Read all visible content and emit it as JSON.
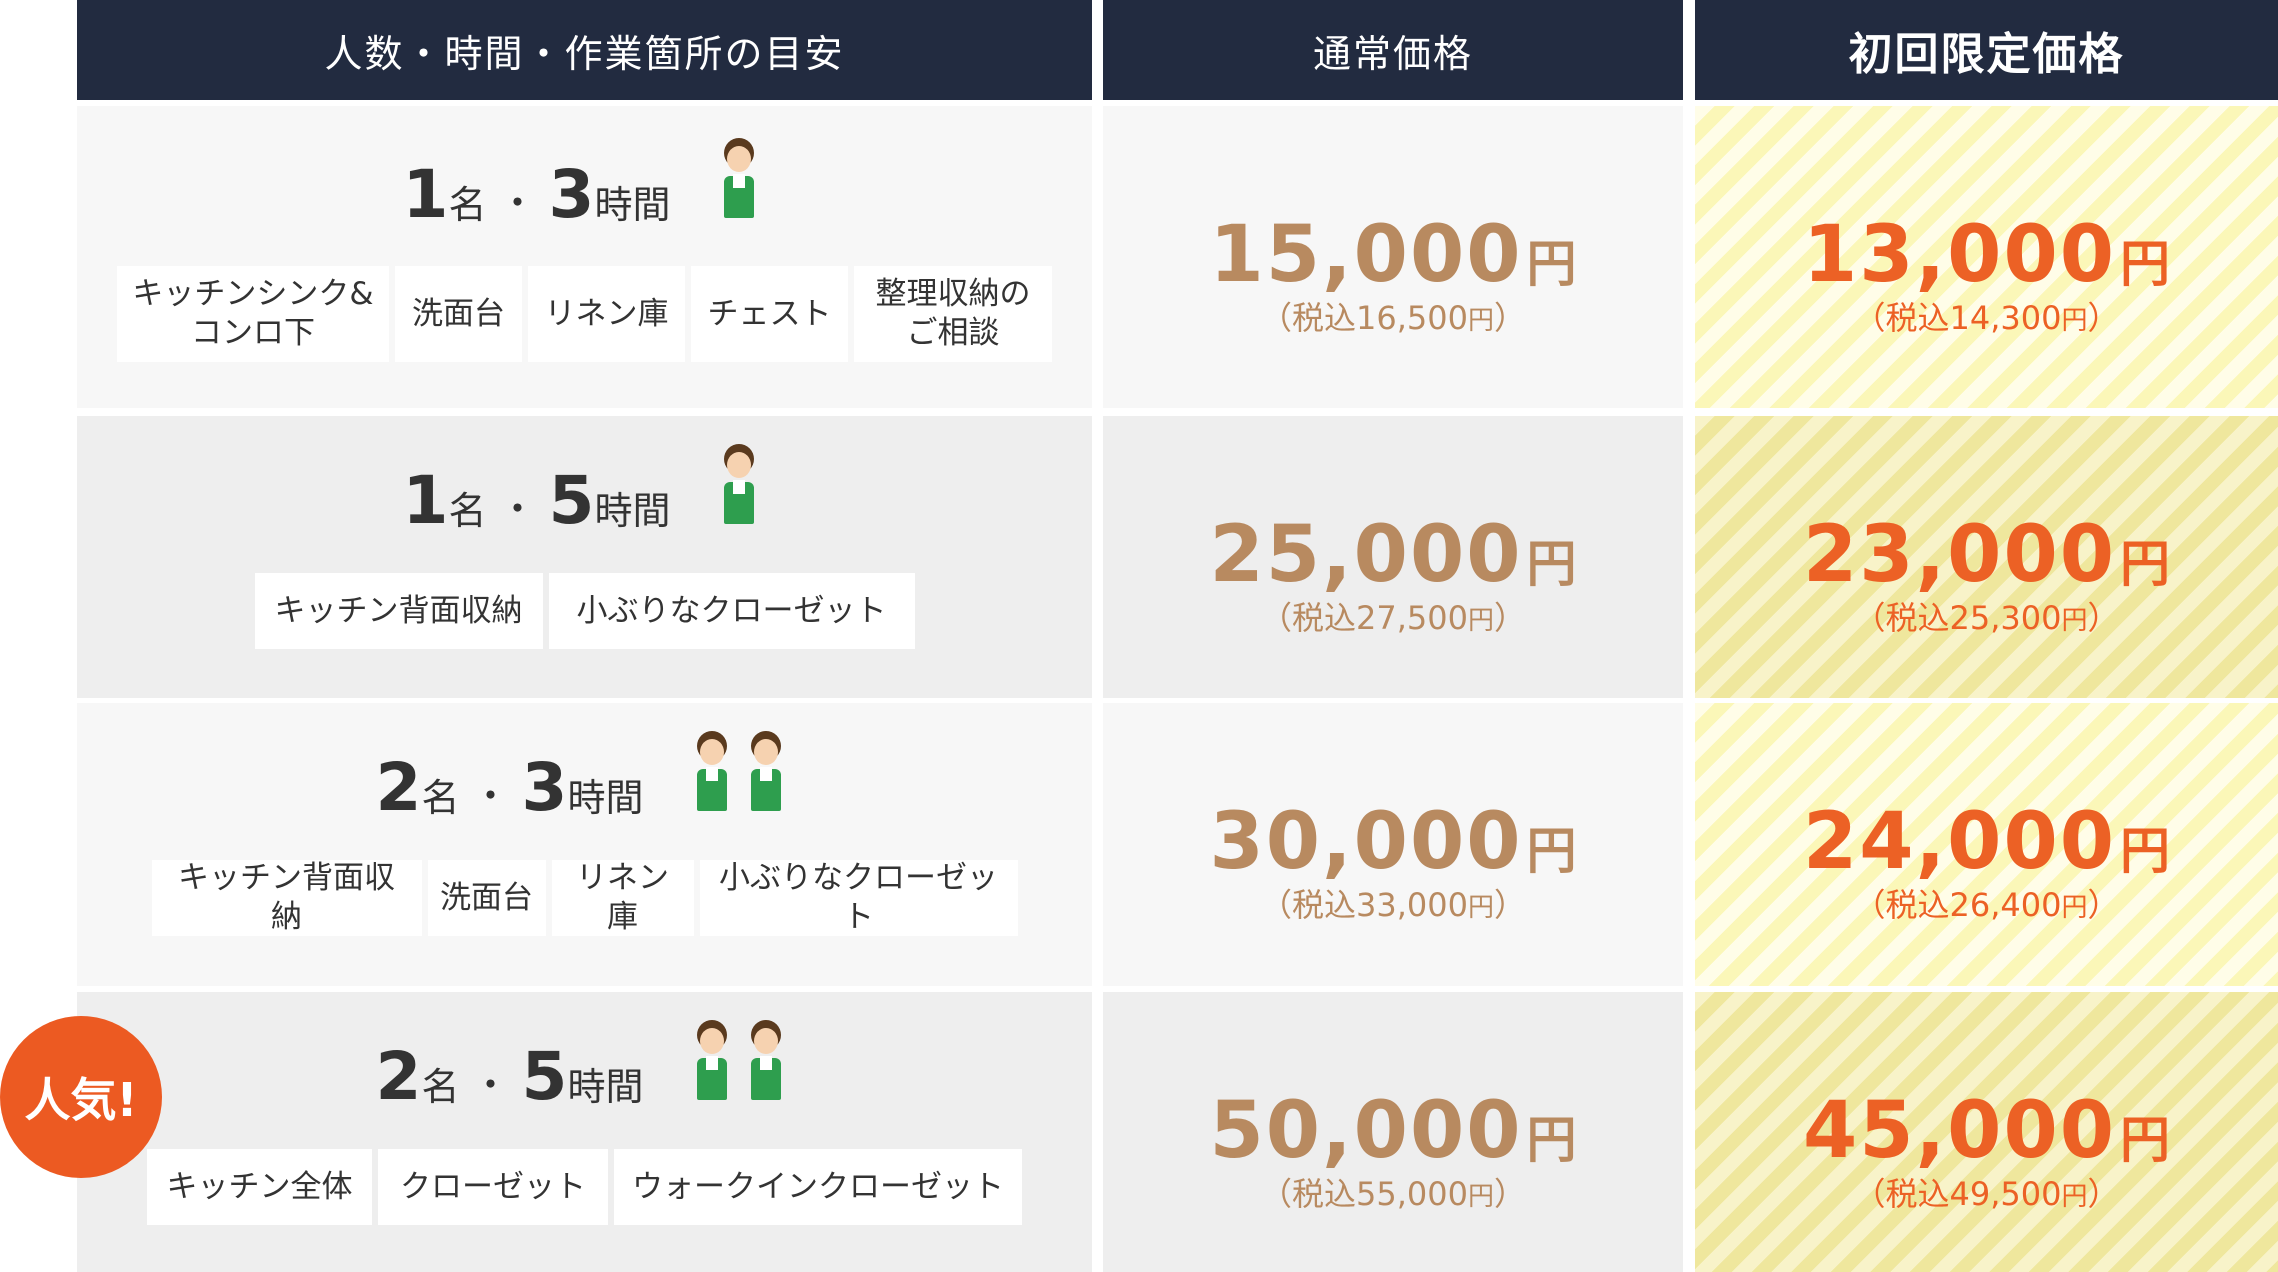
{
  "headers": {
    "col1": "人数・時間・作業箇所の目安",
    "col2": "通常価格",
    "col3": "初回限定価格"
  },
  "rows": [
    {
      "people": "1",
      "people_unit": "名",
      "hours": "3",
      "hours_unit": "時間",
      "staff_icons": [
        "staff-icon"
      ],
      "tags": [
        "キッチンシンク&\nコンロ下",
        "洗面台",
        "リネン庫",
        "チェスト",
        "整理収納の\nご相談"
      ],
      "regular_price": "15,000",
      "regular_tax_label": "（税込16,500",
      "regular_tax_close": "）",
      "intro_price": "13,000",
      "intro_tax_label": "（税込14,300",
      "intro_tax_close": "）"
    },
    {
      "people": "1",
      "people_unit": "名",
      "hours": "5",
      "hours_unit": "時間",
      "staff_icons": [
        "staff-icon"
      ],
      "tags": [
        "キッチン背面収納",
        "小ぶりなクローゼット"
      ],
      "regular_price": "25,000",
      "regular_tax_label": "（税込27,500",
      "regular_tax_close": "）",
      "intro_price": "23,000",
      "intro_tax_label": "（税込25,300",
      "intro_tax_close": "）"
    },
    {
      "people": "2",
      "people_unit": "名",
      "hours": "3",
      "hours_unit": "時間",
      "staff_icons": [
        "staff-icon",
        "staff-icon"
      ],
      "tags": [
        "キッチン背面収納",
        "洗面台",
        "リネン庫",
        "小ぶりなクローゼット"
      ],
      "regular_price": "30,000",
      "regular_tax_label": "（税込33,000",
      "regular_tax_close": "）",
      "intro_price": "24,000",
      "intro_tax_label": "（税込26,400",
      "intro_tax_close": "）"
    },
    {
      "people": "2",
      "people_unit": "名",
      "hours": "5",
      "hours_unit": "時間",
      "staff_icons": [
        "staff-icon",
        "staff-icon"
      ],
      "tags": [
        "キッチン全体",
        "クローゼット",
        "ウォークインクローゼット"
      ],
      "regular_price": "50,000",
      "regular_tax_label": "（税込55,000",
      "regular_tax_close": "）",
      "intro_price": "45,000",
      "intro_tax_label": "（税込49,500",
      "intro_tax_close": "）"
    }
  ],
  "yen": "円",
  "dot": "・",
  "popular_badge": "人気!",
  "colors": {
    "header_bg": "#222b40",
    "regular_price": "#b88a60",
    "intro_price": "#ec6125",
    "badge": "#ec5a22",
    "apron": "#2e9e4e"
  }
}
